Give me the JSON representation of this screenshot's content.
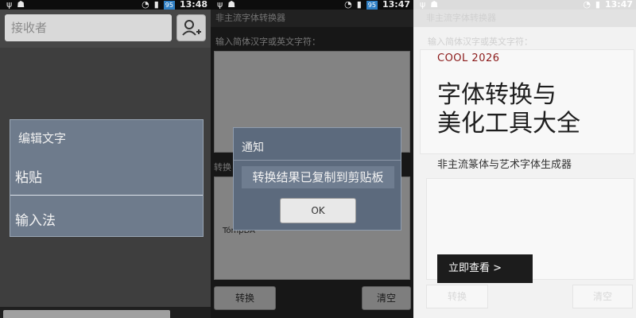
{
  "status_bars": [
    {
      "time": "13:48",
      "battery": "95"
    },
    {
      "time": "13:47",
      "battery": "95"
    },
    {
      "time": "13:47",
      "battery": ""
    }
  ],
  "panel1": {
    "recipient_placeholder": "接收者",
    "menu_title": "编辑文字",
    "menu_items": [
      "粘贴",
      "输入法"
    ]
  },
  "panel2": {
    "app_title": "非主流字体转换器",
    "input_label": "输入简体汉字或英文字符：",
    "result_label": "转换",
    "result_text": "TómpDA",
    "convert_button": "转换",
    "clear_button": "清空",
    "dialog_title": "通知",
    "dialog_message": "转换结果已复制到剪贴板",
    "dialog_ok": "OK"
  },
  "panel3": {
    "app_title": "非主流字体转换器",
    "input_label": "输入简体汉字或英文字符：",
    "convert_button": "转换",
    "clear_button": "清空",
    "brand": "COOL 2026",
    "headline_line1": "字体转换与",
    "headline_line2": "美化工具大全",
    "subhead": "非主流篆体与艺术字体生成器",
    "cta": "立即查看 >"
  },
  "colors": {
    "accent_dark": "#1c1c1c",
    "brand_red": "#8b1a1a",
    "dialog_blue": "#5c6a7d"
  }
}
